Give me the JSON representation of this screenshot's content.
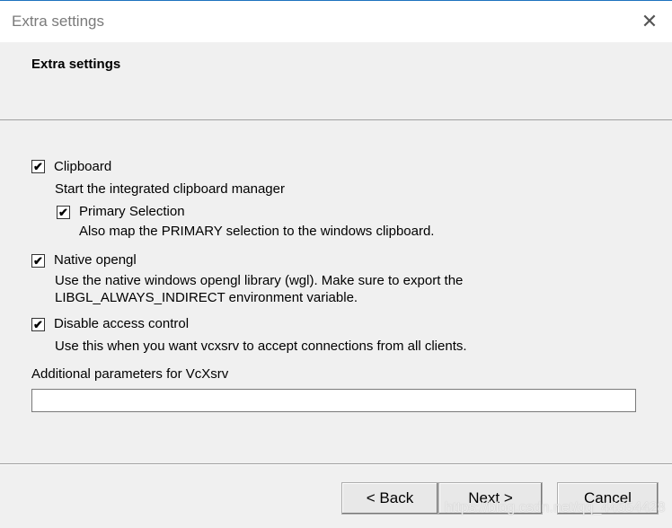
{
  "window": {
    "title": "Extra settings",
    "close_icon": "close-icon"
  },
  "header": {
    "title": "Extra settings"
  },
  "options": {
    "clipboard": {
      "label": "Clipboard",
      "checked": true,
      "description": "Start the integrated clipboard manager"
    },
    "primary": {
      "label": "Primary Selection",
      "checked": true,
      "description": "Also map the PRIMARY selection to the windows clipboard."
    },
    "opengl": {
      "label": "Native opengl",
      "checked": true,
      "description1": "Use the native windows opengl library (wgl). Make sure to export the",
      "description2": "LIBGL_ALWAYS_INDIRECT environment variable."
    },
    "access": {
      "label": "Disable access control",
      "checked": true,
      "description": "Use this when you want vcxsrv to accept connections from all clients."
    }
  },
  "params": {
    "label": "Additional parameters for VcXsrv",
    "value": ""
  },
  "buttons": {
    "back": "< Back",
    "next": "Next >",
    "cancel": "Cancel"
  },
  "watermark": "https://blog.csdn.net/qq_44554428"
}
